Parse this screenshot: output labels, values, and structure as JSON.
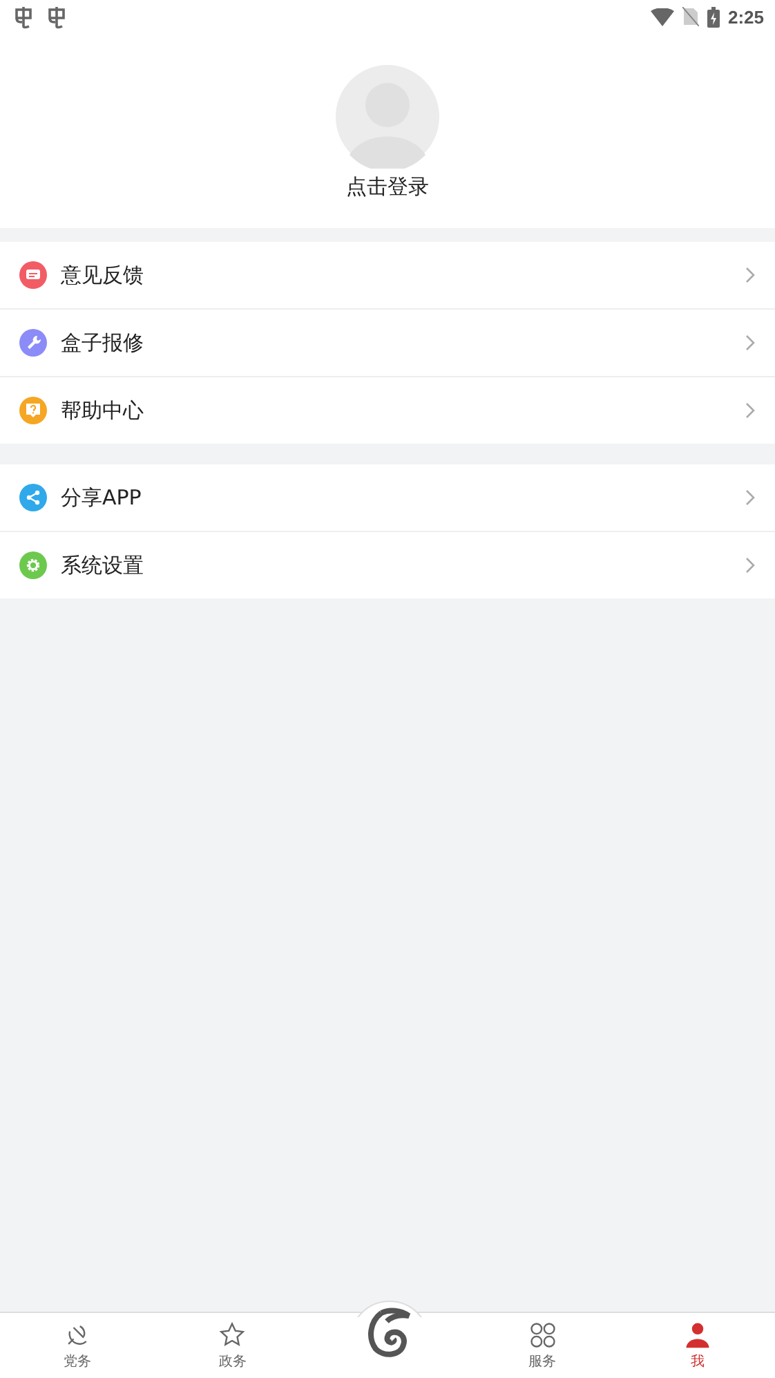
{
  "status_bar": {
    "time": "2:25"
  },
  "profile": {
    "login": "点击登录"
  },
  "menu_groups": [
    {
      "items": [
        {
          "label": "意见反馈",
          "color": "#f25c64"
        },
        {
          "label": "盒子报修",
          "color": "#8b8cf8"
        },
        {
          "label": "帮助中心",
          "color": "#f5a623"
        }
      ]
    },
    {
      "items": [
        {
          "label": "分享APP",
          "color": "#2fa9ea"
        },
        {
          "label": "系统设置",
          "color": "#6cc94e"
        }
      ]
    }
  ],
  "tab_bar": [
    {
      "kind": "tab",
      "label": "党务",
      "selected": false
    },
    {
      "kind": "tab",
      "label": "政务",
      "selected": false
    },
    {
      "kind": "logo",
      "selected": false
    },
    {
      "kind": "tab",
      "label": "服务",
      "selected": false
    },
    {
      "kind": "tab",
      "label": "我",
      "selected": true
    }
  ]
}
